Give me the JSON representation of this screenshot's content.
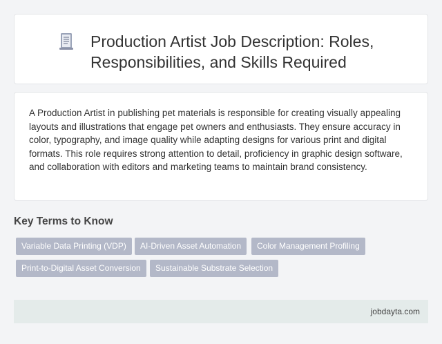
{
  "header": {
    "icon": "document-icon",
    "title": "Production Artist Job Description: Roles, Responsibilities, and Skills Required"
  },
  "description": {
    "text": "A Production Artist in publishing pet materials is responsible for creating visually appealing layouts and illustrations that engage pet owners and enthusiasts. They ensure accuracy in color, typography, and image quality while adapting designs for various print and digital formats. This role requires strong attention to detail, proficiency in graphic design software, and collaboration with editors and marketing teams to maintain brand consistency."
  },
  "key_terms": {
    "heading": "Key Terms to Know",
    "tags": [
      "Variable Data Printing (VDP)",
      "AI-Driven Asset Automation",
      "Color Management Profiling",
      "Print-to-Digital Asset Conversion",
      "Sustainable Substrate Selection"
    ]
  },
  "footer": {
    "site": "jobdayta.com"
  },
  "colors": {
    "tag_background": "#b3b8c8",
    "footer_background": "#e4ebea",
    "page_background": "#f3f4f6"
  }
}
